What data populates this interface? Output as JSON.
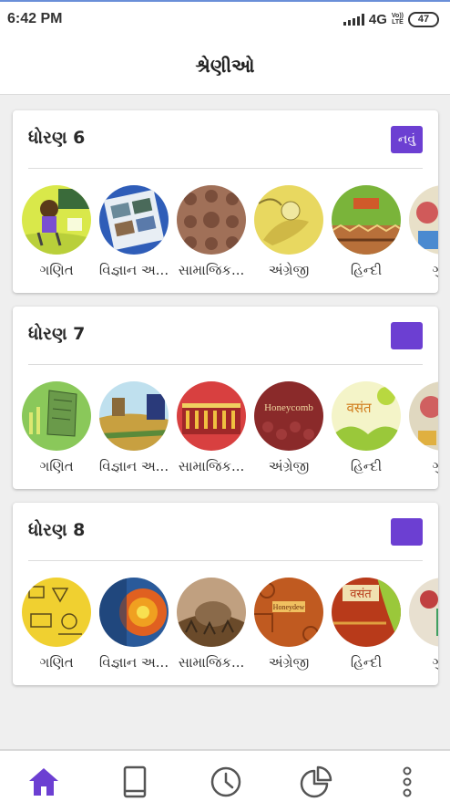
{
  "status_bar": {
    "time": "6:42 PM",
    "network": "4G",
    "volte": [
      "Vo))",
      "LTE"
    ],
    "battery": "47"
  },
  "app_bar": {
    "title": "શ્રેણીઓ"
  },
  "colors": {
    "accent": "#6c3fd2",
    "inactive_icon": "#555555"
  },
  "sections": [
    {
      "title": "ધોરણ 6",
      "badge": "નવું",
      "subjects": [
        {
          "label": "ગણિત",
          "art": "math6"
        },
        {
          "label": "વિજ્ઞાન અ...",
          "art": "sci6"
        },
        {
          "label": "સામાજિક...",
          "art": "soc6"
        },
        {
          "label": "અંગ્રેજી",
          "art": "eng6"
        },
        {
          "label": "હિન્દી",
          "art": "hin6"
        },
        {
          "label": "ગુજ",
          "art": "guj6"
        }
      ]
    },
    {
      "title": "ધોરણ 7",
      "badge": "",
      "subjects": [
        {
          "label": "ગણિત",
          "art": "math7"
        },
        {
          "label": "વિજ્ઞાન અ...",
          "art": "sci7"
        },
        {
          "label": "સામાજિક...",
          "art": "soc7"
        },
        {
          "label": "અંગ્રેજી",
          "art": "eng7",
          "cover_text": "Honeycomb"
        },
        {
          "label": "હિન્દી",
          "art": "hin7",
          "cover_text": "वसंत"
        },
        {
          "label": "ગુજ",
          "art": "guj7"
        }
      ]
    },
    {
      "title": "ધોરણ 8",
      "badge": "",
      "subjects": [
        {
          "label": "ગણિત",
          "art": "math8"
        },
        {
          "label": "વિજ્ઞાન અ...",
          "art": "sci8"
        },
        {
          "label": "સામાજિક...",
          "art": "soc8"
        },
        {
          "label": "અંગ્રેજી",
          "art": "eng8",
          "cover_text": "Honeydew"
        },
        {
          "label": "હિન્દી",
          "art": "hin8",
          "cover_text": "वसंत"
        },
        {
          "label": "ગુજ",
          "art": "guj8"
        }
      ]
    }
  ],
  "bottom_nav": [
    {
      "icon": "home-icon",
      "active": true
    },
    {
      "icon": "book-icon",
      "active": false
    },
    {
      "icon": "clock-icon",
      "active": false
    },
    {
      "icon": "pie-chart-icon",
      "active": false
    },
    {
      "icon": "more-vertical-icon",
      "active": false
    }
  ]
}
